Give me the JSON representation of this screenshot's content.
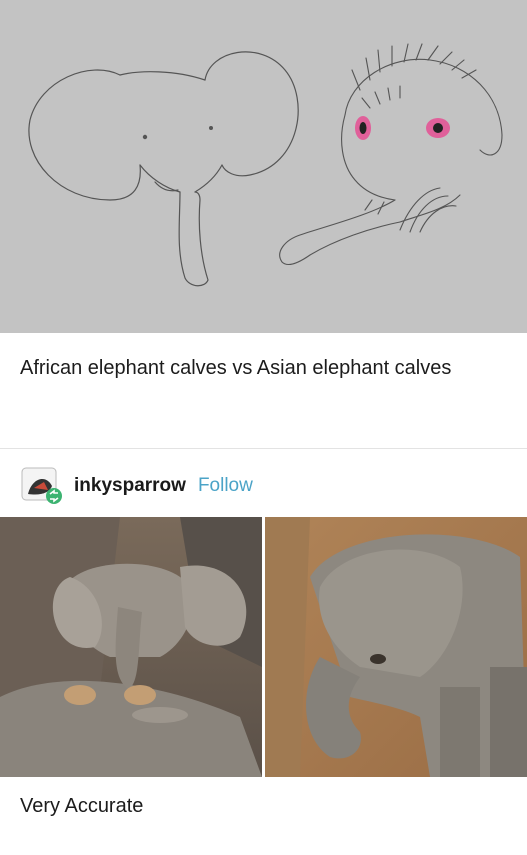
{
  "post": {
    "caption": "African elephant calves vs Asian elephant calves",
    "reblog": {
      "username": "inkysparrow",
      "follow_label": "Follow"
    },
    "footer_text": "Very Accurate"
  },
  "colors": {
    "sketch_background": "#c3c3c3",
    "follow_link": "#4ba3c7",
    "reblog_badge": "#3cb371",
    "eye_ring": "#e0609a"
  }
}
